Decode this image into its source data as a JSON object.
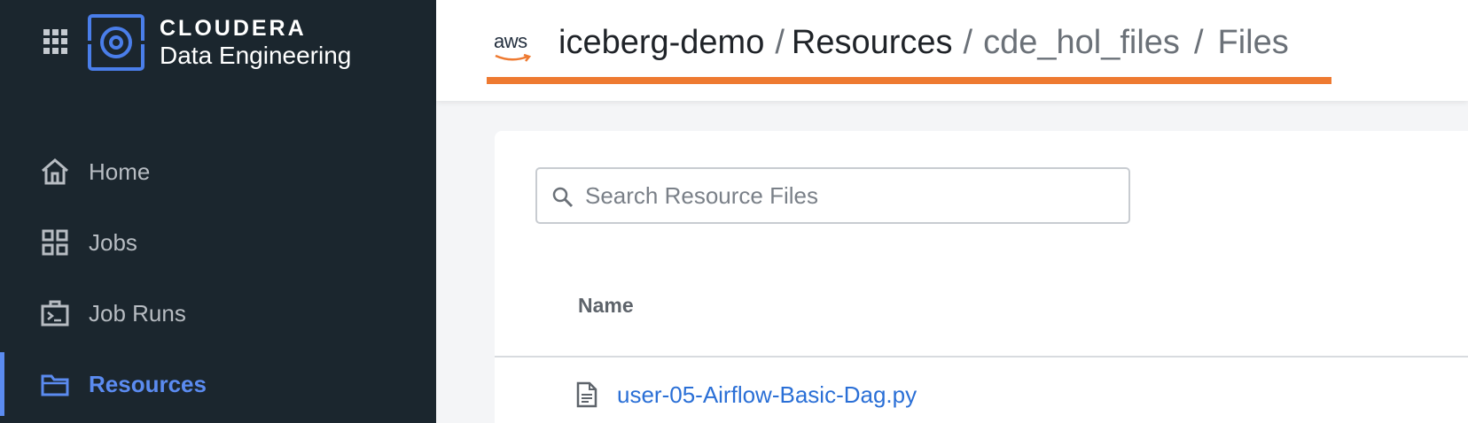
{
  "brand": {
    "name": "CLOUDERA",
    "product": "Data Engineering",
    "accent_color": "#4a7eea"
  },
  "sidebar": {
    "items": [
      {
        "label": "Home",
        "icon": "home-icon",
        "active": false
      },
      {
        "label": "Jobs",
        "icon": "grid-icon",
        "active": false
      },
      {
        "label": "Job Runs",
        "icon": "terminal-icon",
        "active": false
      },
      {
        "label": "Resources",
        "icon": "folder-icon",
        "active": true
      }
    ]
  },
  "header": {
    "cloud_logo": "aws",
    "breadcrumb": [
      "iceberg-demo",
      "Resources",
      "cde_hol_files",
      "Files"
    ],
    "separator": "/",
    "underline_color": "#ee7a31"
  },
  "main": {
    "search": {
      "placeholder": "Search Resource Files",
      "value": ""
    },
    "table": {
      "columns": [
        "Name"
      ],
      "rows": [
        {
          "name": "user-05-Airflow-Basic-Dag.py",
          "icon": "file-icon"
        }
      ]
    }
  }
}
